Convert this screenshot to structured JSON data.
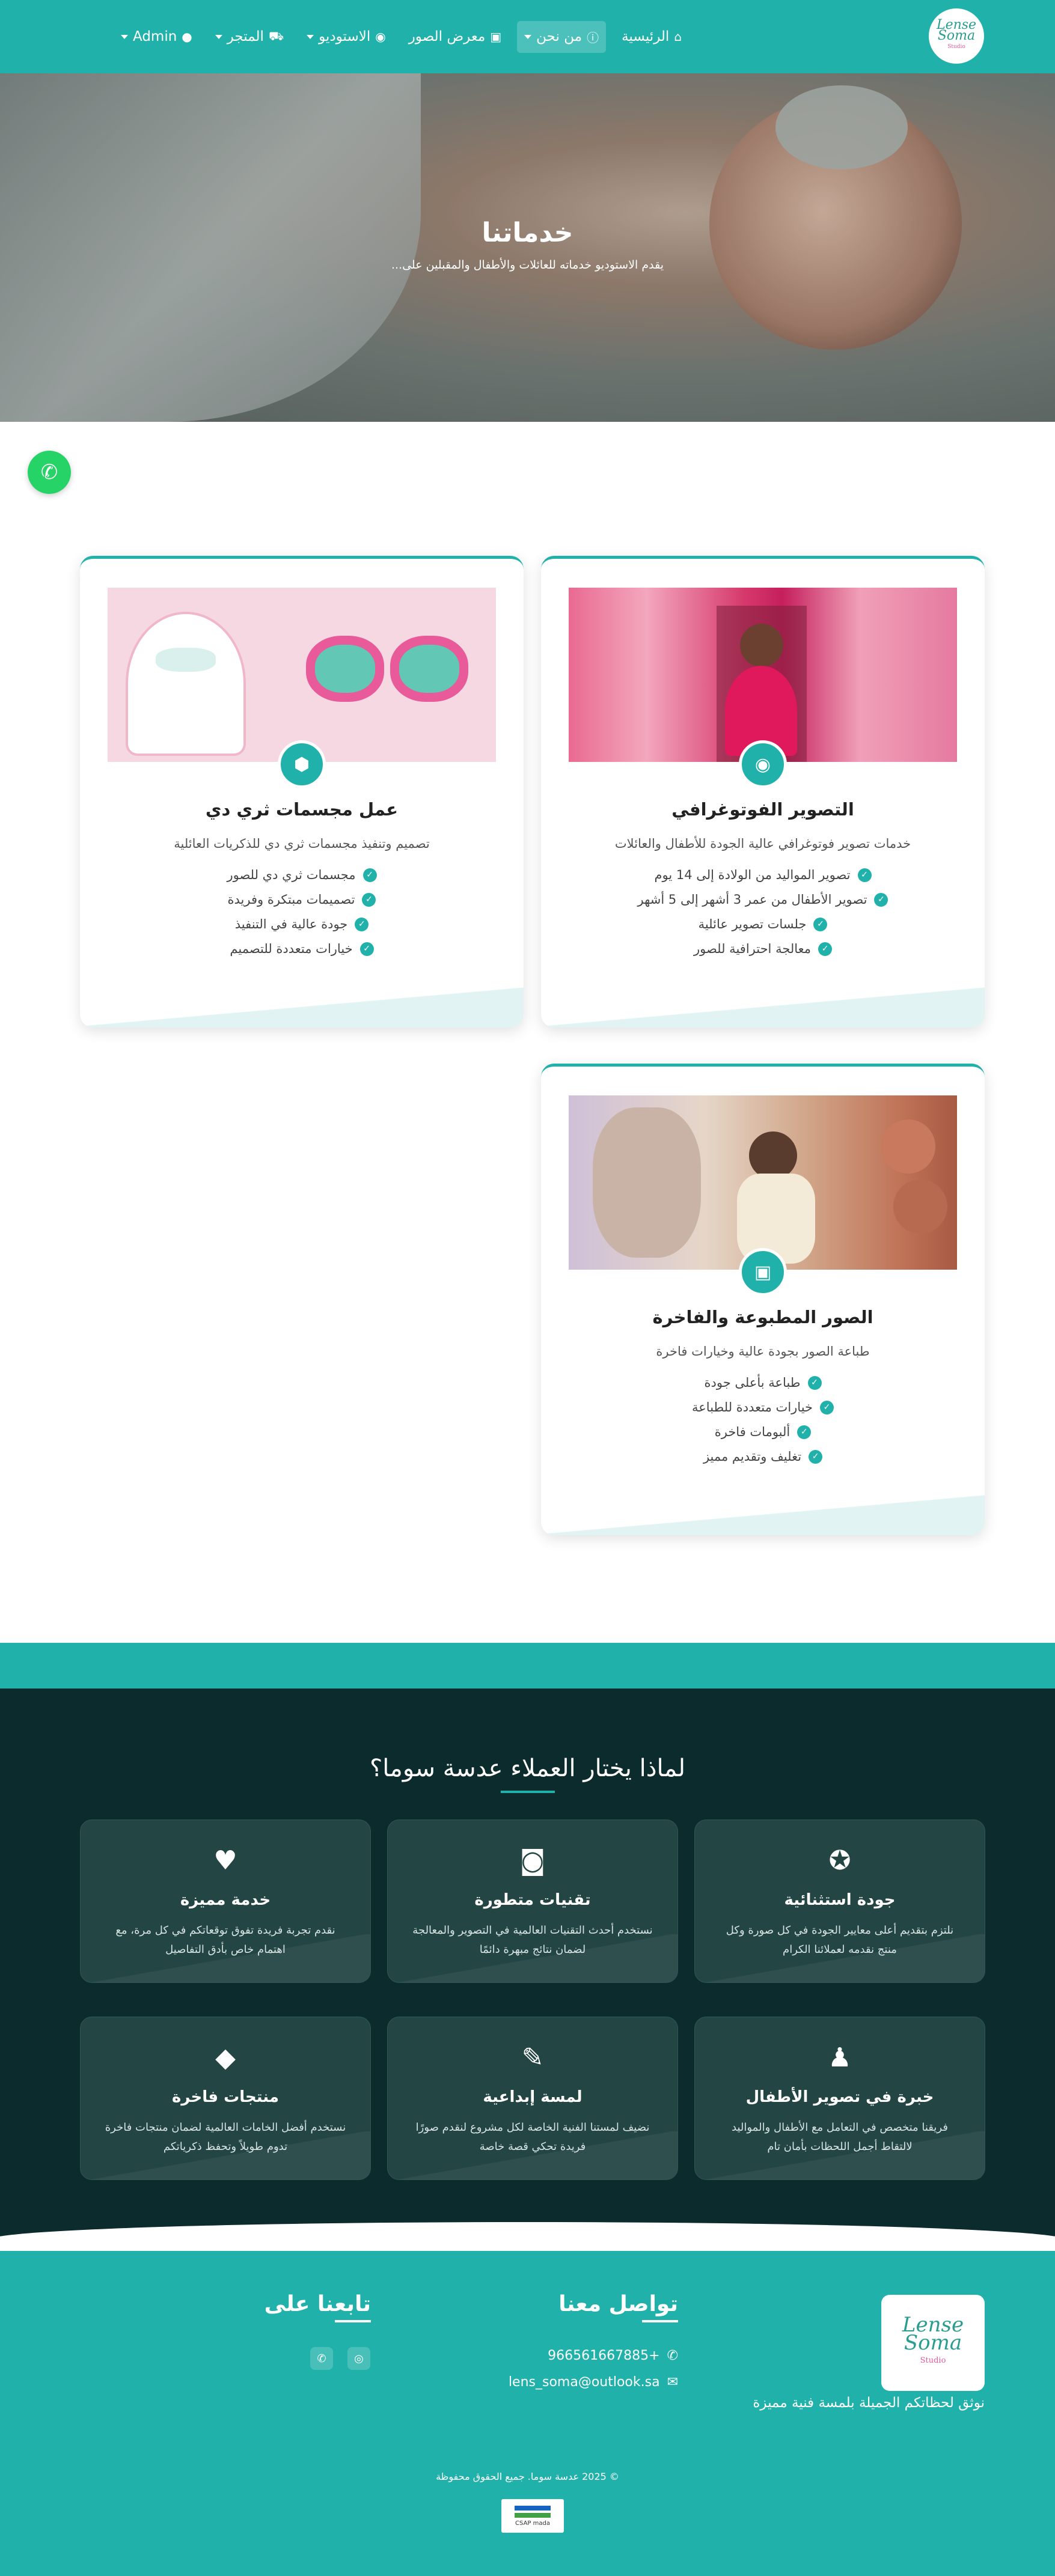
{
  "nav": {
    "logo": {
      "line1": "Lense",
      "line2": "Soma",
      "line3": "Studio"
    },
    "items": [
      {
        "label": "الرئيسية",
        "icon": "home-icon",
        "glyph": "⌂",
        "dropdown": false,
        "active": false
      },
      {
        "label": "من نحن",
        "icon": "info-icon",
        "glyph": "ⓘ",
        "dropdown": true,
        "active": true
      },
      {
        "label": "معرض الصور",
        "icon": "images-icon",
        "glyph": "▣",
        "dropdown": false,
        "active": false
      },
      {
        "label": "الاستوديو",
        "icon": "camera-icon",
        "glyph": "◉",
        "dropdown": true,
        "active": false
      },
      {
        "label": "المتجر",
        "icon": "cart-icon",
        "glyph": "⛟",
        "dropdown": true,
        "active": false
      },
      {
        "label": "Admin",
        "icon": "user-icon",
        "glyph": "●",
        "dropdown": true,
        "active": false
      }
    ]
  },
  "hero": {
    "title": "خدماتنا",
    "subtitle": "يقدم الاستوديو خدماته للعائلات والأطفال والمقبلين على..."
  },
  "services": [
    {
      "title": "التصوير الفوتوغرافي",
      "description": "خدمات تصوير فوتوغرافي عالية الجودة للأطفال والعائلات",
      "icon": "camera-icon",
      "features": [
        "تصوير المواليد من الولادة إلى 14 يوم",
        "تصوير الأطفال من عمر 3 أشهر إلى 5 أشهر",
        "جلسات تصوير عائلية",
        "معالجة احترافية للصور"
      ]
    },
    {
      "title": "عمل مجسمات ثري دي",
      "description": "تصميم وتنفيذ مجسمات ثري دي للذكريات العائلية",
      "icon": "cube-icon",
      "features": [
        "مجسمات ثري دي للصور",
        "تصميمات مبتكرة وفريدة",
        "جودة عالية في التنفيذ",
        "خيارات متعددة للتصميم"
      ]
    },
    {
      "title": "الصور المطبوعة والفاخرة",
      "description": "طباعة الصور بجودة عالية وخيارات فاخرة",
      "icon": "photo-icon",
      "features": [
        "طباعة بأعلى جودة",
        "خيارات متعددة للطباعة",
        "ألبومات فاخرة",
        "تغليف وتقديم مميز"
      ]
    }
  ],
  "why": {
    "title": "لماذا يختار العملاء عدسة سوما؟",
    "features": [
      {
        "title": "جودة استثنائية",
        "text": "نلتزم بتقديم أعلى معايير الجودة في كل صورة وكل منتج نقدمه لعملائنا الكرام",
        "icon": "award-icon",
        "glyph": "✪"
      },
      {
        "title": "تقنيات متطورة",
        "text": "نستخدم أحدث التقنيات العالمية في التصوير والمعالجة لضمان نتائج مبهرة دائمًا",
        "icon": "camera-retro-icon",
        "glyph": "◙"
      },
      {
        "title": "خدمة مميزة",
        "text": "نقدم تجربة فريدة تفوق توقعاتكم في كل مرة، مع اهتمام خاص بأدق التفاصيل",
        "icon": "heart-icon",
        "glyph": "♥"
      },
      {
        "title": "خبرة في تصوير الأطفال",
        "text": "فريقنا متخصص في التعامل مع الأطفال والمواليد لالتقاط أجمل اللحظات بأمان تام",
        "icon": "child-icon",
        "glyph": "♟"
      },
      {
        "title": "لمسة إبداعية",
        "text": "نضيف لمستنا الفنية الخاصة لكل مشروع لنقدم صورًا فريدة تحكي قصة خاصة",
        "icon": "paintbrush-icon",
        "glyph": "✎"
      },
      {
        "title": "منتجات فاخرة",
        "text": "نستخدم أفضل الخامات العالمية لضمان منتجات فاخرة تدوم طويلاً وتحفظ ذكرياتكم",
        "icon": "gem-icon",
        "glyph": "◆"
      }
    ]
  },
  "footer": {
    "tagline": "نوثق لحظاتكم الجميلة بلمسة فنية مميزة",
    "contact_title": "تواصل معنا",
    "phone": "966561667885+",
    "email": "lens_soma@outlook.sa",
    "follow_title": "تابعنا على",
    "social": [
      {
        "icon": "instagram-icon",
        "glyph": "◎"
      },
      {
        "icon": "whatsapp-icon",
        "glyph": "✆"
      }
    ],
    "copyright": "© 2025 عدسة سوما. جميع الحقوق محفوظة",
    "payment_label": "CSAP mada"
  },
  "colors": {
    "brand": "#20b2aa",
    "dark": "#0b2b2d",
    "whatsapp": "#25d366"
  }
}
